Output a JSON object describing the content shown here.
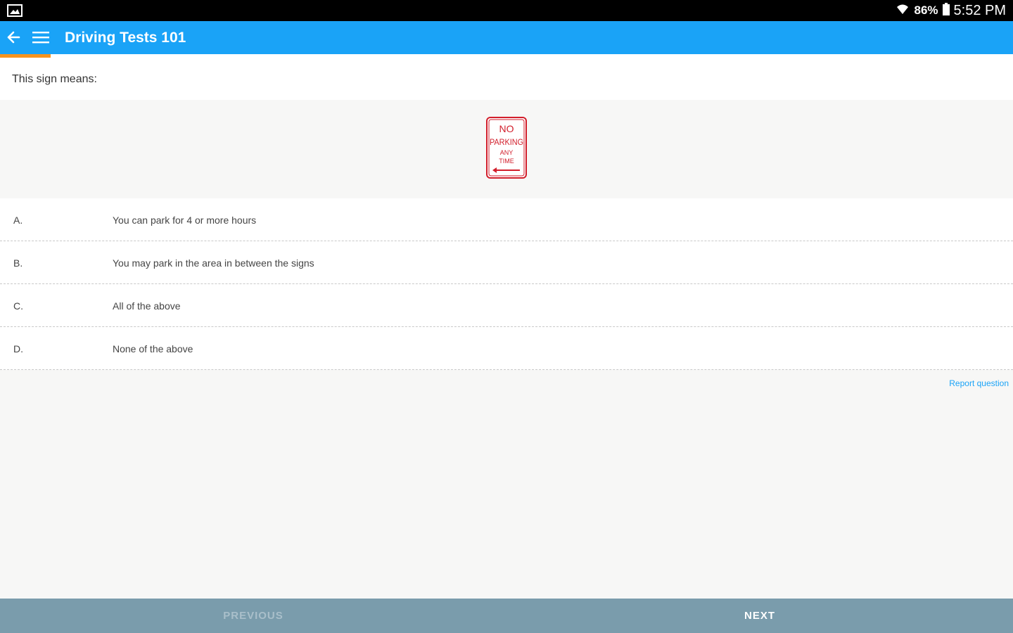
{
  "status_bar": {
    "battery_pct": "86%",
    "time": "5:52 PM"
  },
  "app_bar": {
    "title": "Driving Tests 101",
    "color": "#1aa3f7"
  },
  "progress": {
    "fraction": 0.05,
    "color": "#f7931e"
  },
  "question": {
    "prompt": "This sign means:"
  },
  "sign": {
    "line1": "NO",
    "line2": "PARKING",
    "line3": "ANY",
    "line4": "TIME",
    "color": "#d21e2b"
  },
  "answers": [
    {
      "letter": "A.",
      "text": "You can park for 4 or more hours"
    },
    {
      "letter": "B.",
      "text": "You may park in the area in between the signs"
    },
    {
      "letter": "C.",
      "text": "All of the above"
    },
    {
      "letter": "D.",
      "text": "None of the above"
    }
  ],
  "report_link": "Report question",
  "bottom_bar": {
    "previous_label": "PREVIOUS",
    "next_label": "NEXT"
  }
}
